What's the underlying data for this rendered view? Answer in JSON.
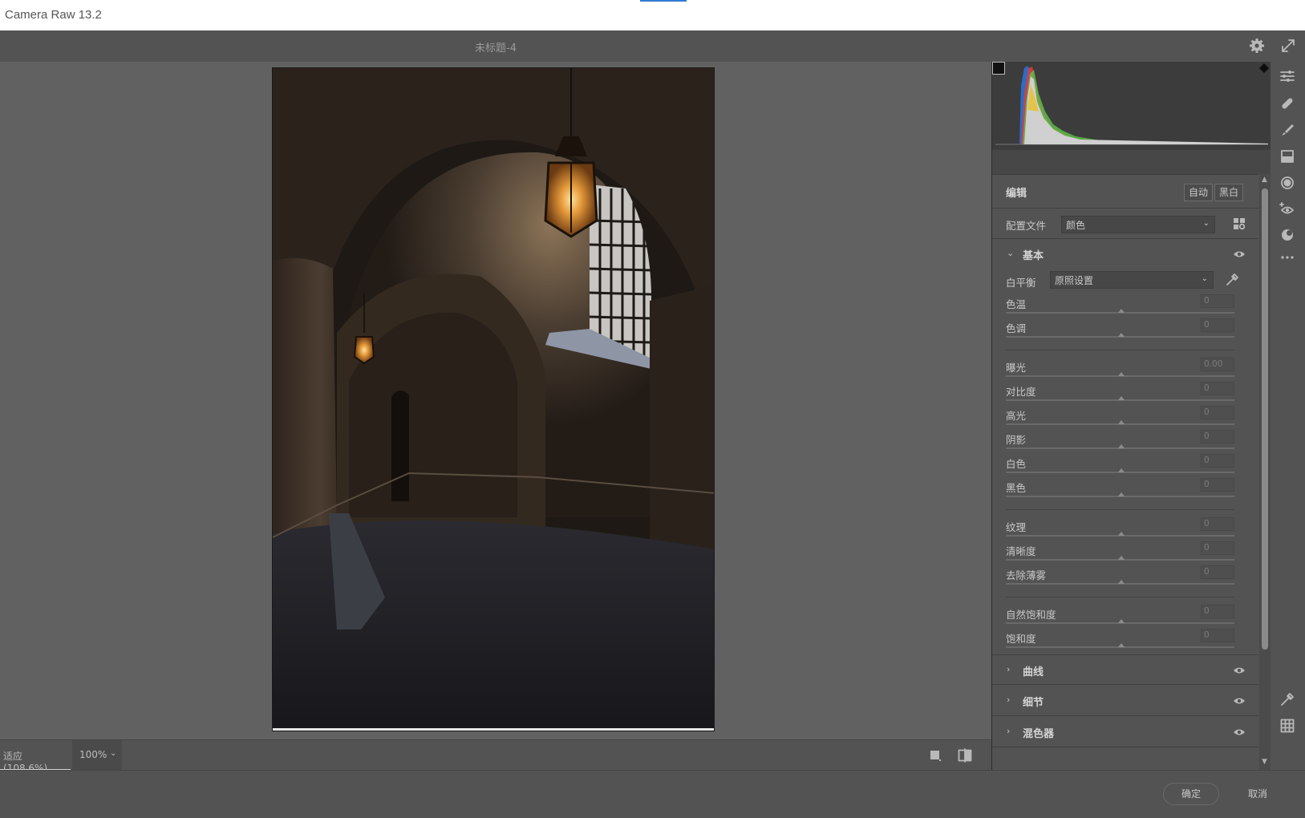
{
  "window": {
    "title": "Camera Raw 13.2"
  },
  "document": {
    "name": "未标题-4"
  },
  "statusbar": {
    "fit_label": "适应 (108.6%)",
    "zoom_value": "100%"
  },
  "panel": {
    "title": "编辑",
    "auto_label": "自动",
    "bw_label": "黑白",
    "profile_label": "配置文件",
    "profile_value": "颜色",
    "basic": {
      "title": "基本",
      "white_balance_label": "白平衡",
      "white_balance_value": "原照设置",
      "sliders": [
        {
          "label": "色温",
          "value": "0"
        },
        {
          "label": "色调",
          "value": "0"
        },
        {
          "label": "曝光",
          "value": "0.00"
        },
        {
          "label": "对比度",
          "value": "0"
        },
        {
          "label": "高光",
          "value": "0"
        },
        {
          "label": "阴影",
          "value": "0"
        },
        {
          "label": "白色",
          "value": "0"
        },
        {
          "label": "黑色",
          "value": "0"
        },
        {
          "label": "纹理",
          "value": "0"
        },
        {
          "label": "清晰度",
          "value": "0"
        },
        {
          "label": "去除薄雾",
          "value": "0"
        },
        {
          "label": "自然饱和度",
          "value": "0"
        },
        {
          "label": "饱和度",
          "value": "0"
        }
      ]
    },
    "sections": [
      {
        "title": "曲线"
      },
      {
        "title": "细节"
      },
      {
        "title": "混色器"
      }
    ]
  },
  "footer": {
    "ok_label": "确定",
    "cancel_label": "取消"
  },
  "tools": [
    "adjust-sliders-icon",
    "healing-icon",
    "brush-icon",
    "gradient-icon",
    "radial-filter-icon",
    "red-eye-icon",
    "presets-icon",
    "more-icon",
    "eyedropper-icon",
    "grid-icon"
  ],
  "colors": {
    "panel_bg": "#535353",
    "canvas_bg": "#616161",
    "histogram_bg": "#3c3c3c"
  }
}
